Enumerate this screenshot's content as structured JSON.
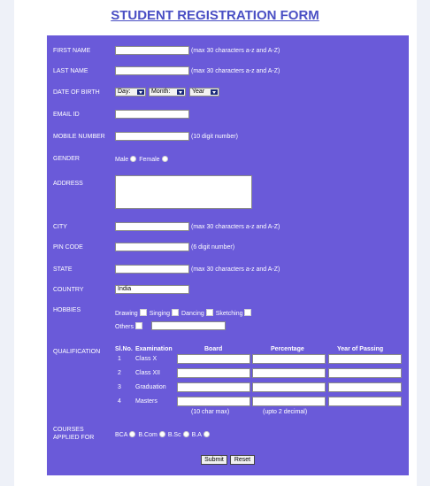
{
  "title": "STUDENT REGISTRATION FORM",
  "labels": {
    "first_name": "FIRST NAME",
    "last_name": "LAST NAME",
    "dob": "DATE OF BIRTH",
    "email": "EMAIL ID",
    "mobile": "MOBILE NUMBER",
    "gender": "GENDER",
    "address": "ADDRESS",
    "city": "CITY",
    "pin": "PIN CODE",
    "state": "STATE",
    "country": "COUNTRY",
    "hobbies": "HOBBIES",
    "qualification": "QUALIFICATION",
    "courses_line1": "COURSES",
    "courses_line2": "APPLIED FOR"
  },
  "hints": {
    "first_name": "(max 30 characters a-z and A-Z)",
    "last_name": "(max 30 characters a-z and A-Z)",
    "mobile": "(10 digit number)",
    "city": "(max 30 characters a-z and A-Z)",
    "pin": "(6 digit number)",
    "state": "(max 30 characters a-z and A-Z)"
  },
  "dob_selects": {
    "day": "Day:",
    "month": "Month:",
    "year": "Year"
  },
  "gender": {
    "male": "Male",
    "female": "Female"
  },
  "country_value": "India",
  "hobbies": {
    "drawing": "Drawing",
    "singing": "Singing",
    "dancing": "Dancing",
    "sketching": "Sketching",
    "others": "Others"
  },
  "qualification": {
    "headers": {
      "slno": "Sl.No.",
      "exam": "Examination",
      "board": "Board",
      "percentage": "Percentage",
      "year": "Year of Passing"
    },
    "rows": [
      {
        "no": "1",
        "exam": "Class X"
      },
      {
        "no": "2",
        "exam": "Class XII"
      },
      {
        "no": "3",
        "exam": "Graduation"
      },
      {
        "no": "4",
        "exam": "Masters"
      }
    ],
    "board_hint": "(10 char max)",
    "percentage_hint": "(upto 2 decimal)"
  },
  "courses": {
    "bca": "BCA",
    "bcom": "B.Com",
    "bsc": "B.Sc",
    "ba": "B.A"
  },
  "buttons": {
    "submit": "Submit",
    "reset": "Reset"
  }
}
